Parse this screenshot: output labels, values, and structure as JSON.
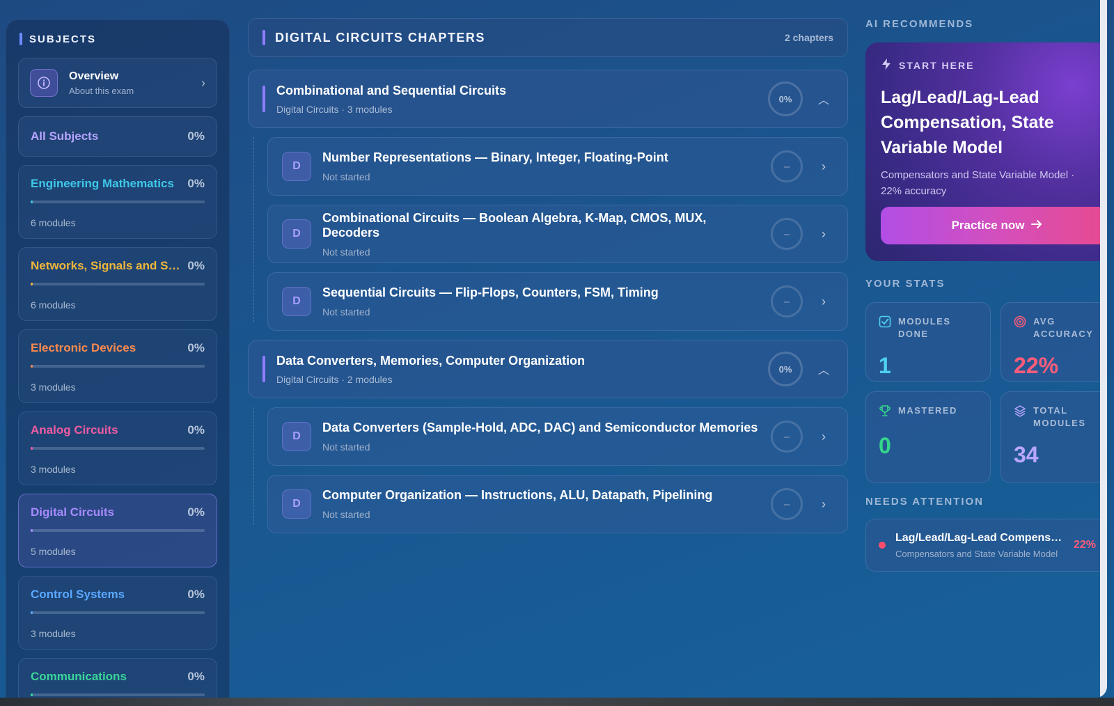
{
  "sidebar": {
    "heading": "SUBJECTS",
    "overview": {
      "title": "Overview",
      "subtitle": "About this exam"
    },
    "all_subjects": {
      "label": "All Subjects",
      "percent": "0%"
    },
    "subjects": [
      {
        "name": "Engineering Mathematics",
        "percent": "0%",
        "modules": "6 modules",
        "color": "#3fc7e8",
        "progress": 0
      },
      {
        "name": "Networks, Signals and Systems",
        "percent": "0%",
        "modules": "6 modules",
        "color": "#f0b63a",
        "progress": 0
      },
      {
        "name": "Electronic Devices",
        "percent": "0%",
        "modules": "3 modules",
        "color": "#ff8a4c",
        "progress": 0
      },
      {
        "name": "Analog Circuits",
        "percent": "0%",
        "modules": "3 modules",
        "color": "#f15ba3",
        "progress": 0
      },
      {
        "name": "Digital Circuits",
        "percent": "0%",
        "modules": "5 modules",
        "color": "#a98bff",
        "progress": 0
      },
      {
        "name": "Control Systems",
        "percent": "0%",
        "modules": "3 modules",
        "color": "#5aa8ff",
        "progress": 0
      },
      {
        "name": "Communications",
        "percent": "0%",
        "modules": "",
        "color": "#3ad69a",
        "progress": 0
      }
    ]
  },
  "main": {
    "title": "DIGITAL CIRCUITS CHAPTERS",
    "count": "2 chapters",
    "chapters": [
      {
        "title": "Combinational and Sequential Circuits",
        "subtitle": "Digital Circuits · 3 modules",
        "percent": "0%",
        "modules": [
          {
            "badge": "D",
            "title": "Number Representations — Binary, Integer, Floating-Point",
            "status": "Not started",
            "ring": "–"
          },
          {
            "badge": "D",
            "title": "Combinational Circuits — Boolean Algebra, K-Map, CMOS, MUX, Decoders",
            "status": "Not started",
            "ring": "–"
          },
          {
            "badge": "D",
            "title": "Sequential Circuits — Flip-Flops, Counters, FSM, Timing",
            "status": "Not started",
            "ring": "–"
          }
        ]
      },
      {
        "title": "Data Converters, Memories, Computer Organization",
        "subtitle": "Digital Circuits · 2 modules",
        "percent": "0%",
        "modules": [
          {
            "badge": "D",
            "title": "Data Converters (Sample-Hold, ADC, DAC) and Semiconductor Memories",
            "status": "Not started",
            "ring": "–"
          },
          {
            "badge": "D",
            "title": "Computer Organization — Instructions, ALU, Datapath, Pipelining",
            "status": "Not started",
            "ring": "–"
          }
        ]
      }
    ]
  },
  "right": {
    "ai_label": "AI RECOMMENDS",
    "rec": {
      "tag": "START HERE",
      "title": "Lag/Lead/Lag-Lead Compensation, State Variable Model",
      "subtitle": "Compensators and State Variable Model · 22% accuracy",
      "button": "Practice now"
    },
    "stats_label": "YOUR STATS",
    "stats": [
      {
        "label": "MODULES DONE",
        "value": "1",
        "color": "#4fd0f0"
      },
      {
        "label": "AVG ACCURACY",
        "value": "22%",
        "color": "#ff5c7a"
      },
      {
        "label": "MASTERED",
        "value": "0",
        "color": "#35d68a"
      },
      {
        "label": "TOTAL MODULES",
        "value": "34",
        "color": "#b8a6ff"
      }
    ],
    "attention_label": "NEEDS ATTENTION",
    "attention": {
      "title": "Lag/Lead/Lag-Lead Compensation, State Variable Model",
      "subtitle": "Compensators and State Variable Model",
      "percent": "22%"
    }
  }
}
